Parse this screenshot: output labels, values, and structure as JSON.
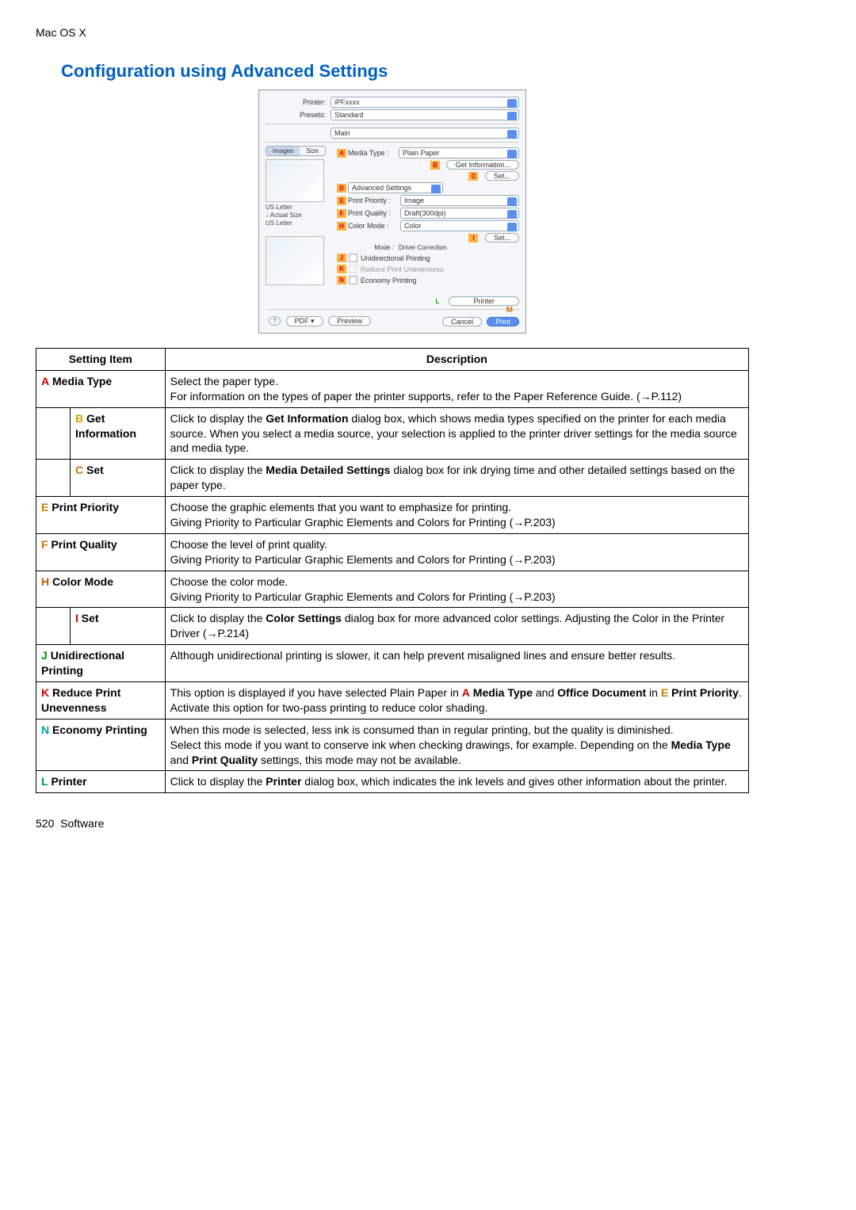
{
  "breadcrumb": "Mac OS X",
  "title": "Configuration using Advanced Settings",
  "dialog": {
    "printer_label": "Printer:",
    "printer_value": "iPFxxxx",
    "presets_label": "Presets:",
    "presets_value": "Standard",
    "panel_value": "Main",
    "tab_images": "Images",
    "tab_size": "Size",
    "media_type_label": "Media Type :",
    "media_type_value": "Plain Paper",
    "get_info": "Get Information...",
    "set": "Set...",
    "adv_settings_label": "Advanced Settings",
    "print_priority_label": "Print Priority :",
    "print_priority_value": "Image",
    "print_quality_label": "Print Quality :",
    "print_quality_value": "Draft(300dpi)",
    "color_mode_label": "Color Mode :",
    "color_mode_value": "Color",
    "mode_label": "Mode :",
    "mode_value": "Driver Correction",
    "unidir": "Unidirectional Printing",
    "reduce": "Reduce Print Unevenness",
    "economy": "Economy Printing",
    "printer_btn": "Printer",
    "us_letter": "US Letter",
    "actual_size": "Actual Size",
    "help": "?",
    "pdf": "PDF ▾",
    "preview": "Preview",
    "cancel": "Cancel",
    "print": "Print",
    "markers": {
      "A": "A",
      "B": "B",
      "C": "C",
      "D": "D",
      "E": "E",
      "F": "F",
      "H": "H",
      "I": "I",
      "J": "J",
      "K": "K",
      "L": "L",
      "M": "M",
      "N": "N"
    }
  },
  "table_header": {
    "item": "Setting Item",
    "desc": "Description"
  },
  "rows": {
    "A": {
      "letter": "A",
      "name": "Media Type",
      "desc": "Select the paper type.\nFor information on the types of paper the printer supports, refer to the Paper Reference Guide. (→P.112)"
    },
    "B": {
      "letter": "B",
      "name": "Get Information",
      "desc_pre": "Click to display the ",
      "desc_bold": "Get Information",
      "desc_post": " dialog box, which shows media types specified on the printer for each media source. When you select a media source, your selection is applied to the printer driver settings for the media source and media type."
    },
    "C": {
      "letter": "C",
      "name": "Set",
      "desc_pre": "Click to display the ",
      "desc_bold": "Media Detailed Settings",
      "desc_post": " dialog box for ink drying time and other detailed settings based on the paper type."
    },
    "E": {
      "letter": "E",
      "name": "Print Priority",
      "desc": "Choose the graphic elements that you want to emphasize for printing.\nGiving Priority to Particular Graphic Elements and Colors for Printing (→P.203)"
    },
    "F": {
      "letter": "F",
      "name": "Print Quality",
      "desc": "Choose the level of print quality.\nGiving Priority to Particular Graphic Elements and Colors for Printing (→P.203)"
    },
    "H": {
      "letter": "H",
      "name": "Color Mode",
      "desc": "Choose the color mode.\nGiving Priority to Particular Graphic Elements and Colors for Printing (→P.203)"
    },
    "I": {
      "letter": "I",
      "name": "Set",
      "desc_pre": "Click to display the ",
      "desc_bold": "Color Settings",
      "desc_post": " dialog box for more advanced color settings. Adjusting the Color in the Printer Driver (→P.214)"
    },
    "J": {
      "letter": "J",
      "name": "Unidirectional Printing",
      "desc": "Although unidirectional printing is slower, it can help prevent misaligned lines and ensure better results."
    },
    "K": {
      "letter": "K",
      "name": "Reduce Print Unevenness",
      "desc_pre": "This option is displayed if you have selected Plain Paper in ",
      "desc_a": "A",
      "desc_a_bold": "Media Type",
      "desc_mid": " and ",
      "desc_office": "Office Document",
      "desc_in": " in ",
      "desc_e": "E",
      "desc_e_bold": "Print Priority",
      "desc_post": ".\nActivate this option for two-pass printing to reduce color shading."
    },
    "N": {
      "letter": "N",
      "name": "Economy Printing",
      "desc_pre": "When this mode is selected, less ink is consumed than in regular printing, but the quality is diminished.\nSelect this mode if you want to conserve ink when checking drawings, for example. Depending on the ",
      "desc_b1": "Media Type",
      "desc_and": " and ",
      "desc_b2": "Print Quality",
      "desc_post": " settings, this mode may not be available."
    },
    "L": {
      "letter": "L",
      "name": "Printer",
      "desc_pre": "Click to display the ",
      "desc_bold": "Printer",
      "desc_post": " dialog box, which indicates the ink levels and gives other information about the printer."
    }
  },
  "footer": {
    "page": "520",
    "section": "Software"
  }
}
